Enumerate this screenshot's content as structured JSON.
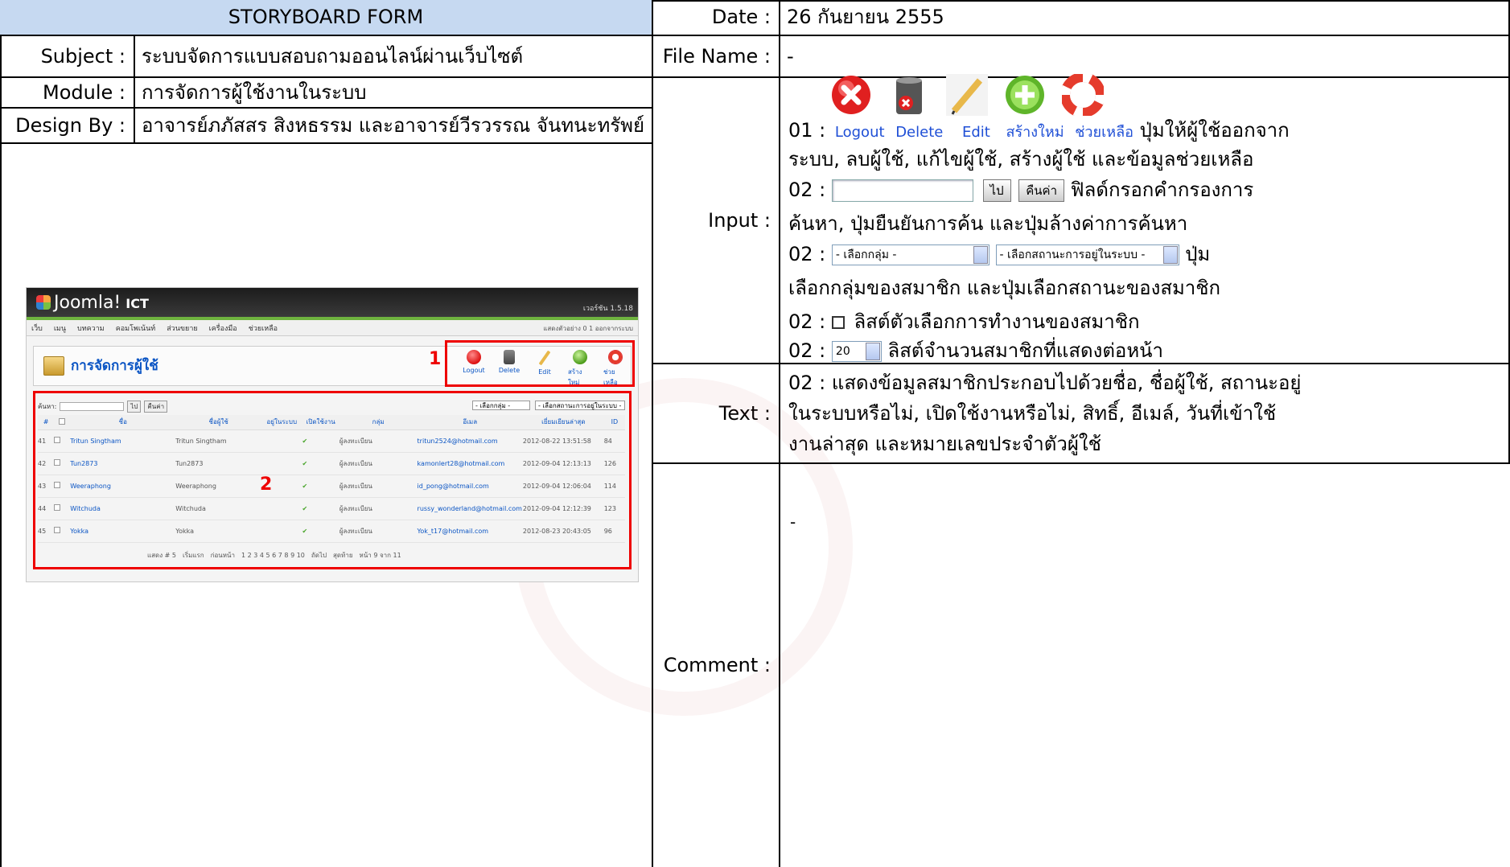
{
  "form": {
    "title": "STORYBOARD FORM",
    "date_label": "Date :",
    "date_value": "26 กันยายน 2555",
    "subject_label": "Subject :",
    "subject_value": "ระบบจัดการแบบสอบถามออนไลน์ผ่านเว็บไซต์",
    "filename_label": "File Name :",
    "filename_value": "-",
    "module_label": "Module :",
    "module_value": "การจัดการผู้ใช้งานในระบบ",
    "design_label": "Design By :",
    "design_value": "อาจารย์ภภัสสร สิงหธรรม และอาจารย์วีรวรรณ จันทนะทรัพย์",
    "input_label": "Input :",
    "text_label": "Text :",
    "comment_label": "Comment :",
    "comment_value": "-"
  },
  "input_notes": {
    "icon_labels": [
      "Logout",
      "Delete",
      "Edit",
      "สร้างใหม่",
      "ช่วยเหลือ"
    ],
    "line1_prefix": "01 :",
    "line1_text": "ปุ่มให้ผู้ใช้ออกจาก",
    "line2_text": "ระบบ, ลบผู้ใช้, แก้ไขผู้ใช้, สร้างผู้ใช้ และข้อมูลช่วยเหลือ",
    "line3_prefix": "02 :",
    "go_button": "ไป",
    "reset_button": "คืนค่า",
    "line3_text": "ฟิลด์กรอกคำกรองการ",
    "line4_text": "ค้นหา, ปุ่มยืนยันการค้น และปุ่มล้างค่าการค้นหา",
    "line5_prefix": "02 :",
    "group_select": "- เลือกกลุ่ม -",
    "status_select": "- เลือกสถานะการอยู่ในระบบ -",
    "line5_text": "ปุ่ม",
    "line6_text": "เลือกกลุ่มของสมาชิก และปุ่มเลือกสถานะของสมาชิก",
    "line7_prefix": "02 :",
    "line7_text": "ลิสต์ตัวเลือกการทำงานของสมาชิก",
    "line8_prefix": "02 :",
    "limit_select": "20",
    "line8_text": "ลิสต์จำนวนสมาชิกที่แสดงต่อหน้า"
  },
  "text_notes": {
    "line1": "02 : แสดงข้อมูลสมาชิกประกอบไปด้วยชื่อ, ชื่อผู้ใช้, สถานะอยู่",
    "line2": "ในระบบหรือไม่, เปิดใช้งานหรือไม่, สิทธิ์, อีเมล์, วันที่เข้าใช้",
    "line3": "งานล่าสุด และหมายเลขประจำตัวผู้ใช้"
  },
  "joomla": {
    "brand": "Joomla!",
    "site": "ICT",
    "version": "เวอร์ชัน 1.5.18",
    "menu": [
      "เว็บ",
      "เมนู",
      "บทความ",
      "คอมโพเน้นท์",
      "ส่วนขยาย",
      "เครื่องมือ",
      "ช่วยเหลือ"
    ],
    "menu_right": "แสดงตัวอย่าง  0  1  ออกจากระบบ",
    "page_title": "การจัดการผู้ใช้",
    "toolbar": [
      "Logout",
      "Delete",
      "Edit",
      "สร้างใหม่",
      "ช่วยเหลือ"
    ],
    "marker1": "1",
    "marker2": "2",
    "search_label": "ค้นหา:",
    "search_go": "ไป",
    "search_reset": "คืนค่า",
    "filter_group": "- เลือกกลุ่ม -",
    "filter_status": "- เลือกสถานะการอยู่ในระบบ -",
    "columns": [
      "#",
      "",
      "ชื่อ",
      "ชื่อผู้ใช้",
      "อยู่ในระบบ",
      "เปิดใช้งาน",
      "กลุ่ม",
      "อีเมล",
      "เยี่ยมเยียนล่าสุด",
      "ID"
    ],
    "rows": [
      {
        "num": "41",
        "name": "Tritun Singtham",
        "username": "Tritun Singtham",
        "group": "ผู้ลงทะเบียน",
        "email": "tritun2524@hotmail.com",
        "last": "2012-08-22 13:51:58",
        "id": "84"
      },
      {
        "num": "42",
        "name": "Tun2873",
        "username": "Tun2873",
        "group": "ผู้ลงทะเบียน",
        "email": "kamonlert28@hotmail.com",
        "last": "2012-09-04 12:13:13",
        "id": "126"
      },
      {
        "num": "43",
        "name": "Weeraphong",
        "username": "Weeraphong",
        "group": "ผู้ลงทะเบียน",
        "email": "id_pong@hotmail.com",
        "last": "2012-09-04 12:06:04",
        "id": "114"
      },
      {
        "num": "44",
        "name": "Witchuda",
        "username": "Witchuda",
        "group": "ผู้ลงทะเบียน",
        "email": "russy_wonderland@hotmail.com",
        "last": "2012-09-04 12:12:39",
        "id": "123"
      },
      {
        "num": "45",
        "name": "Yokka",
        "username": "Yokka",
        "group": "ผู้ลงทะเบียน",
        "email": "Yok_t17@hotmail.com",
        "last": "2012-08-23 20:43:05",
        "id": "96"
      }
    ],
    "pager": [
      "แสดง # 5",
      "เริ่มแรก",
      "ก่อนหน้า",
      "1 2 3 4 5 6 7 8 9 10",
      "ถัดไป",
      "สุดท้าย",
      "หน้า 9 จาก 11"
    ]
  }
}
